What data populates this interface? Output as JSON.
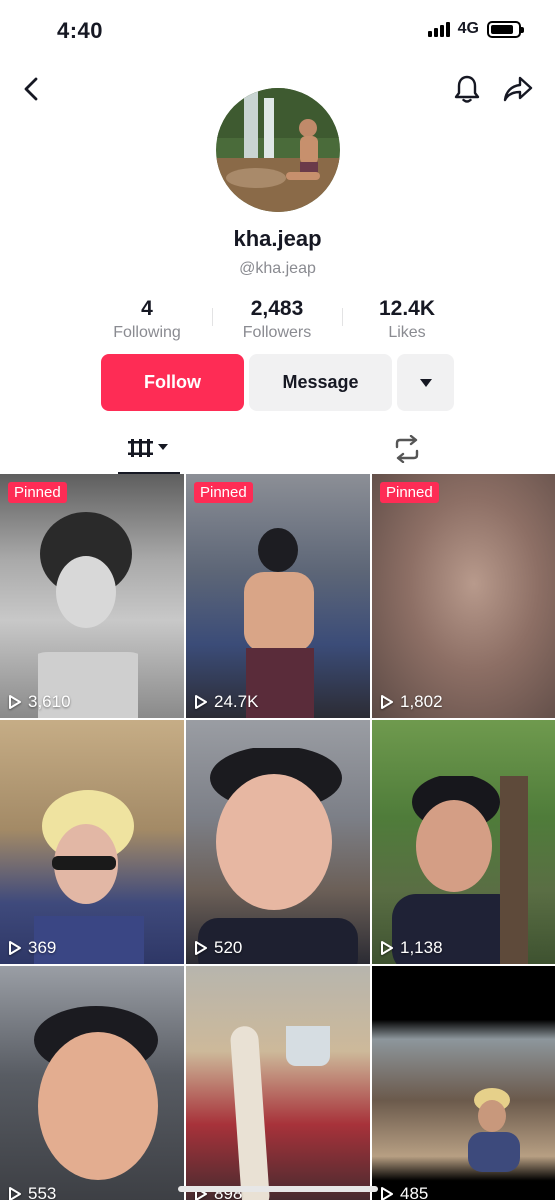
{
  "status_bar": {
    "time": "4:40",
    "network": "4G",
    "battery_level": 0.85
  },
  "nav": {
    "back_icon": "chevron-left-icon",
    "bell_icon": "bell-icon",
    "share_icon": "share-arrow-icon"
  },
  "profile": {
    "name": "kha.jeap",
    "handle": "@kha.jeap",
    "stats": [
      {
        "value": "4",
        "label": "Following"
      },
      {
        "value": "2,483",
        "label": "Followers"
      },
      {
        "value": "12.4K",
        "label": "Likes"
      }
    ]
  },
  "actions": {
    "follow": "Follow",
    "message": "Message"
  },
  "colors": {
    "accent": "#fe2c55",
    "secondary_bg": "#f1f1f2",
    "muted_text": "#8a8b91"
  },
  "videos": [
    {
      "pinned": "Pinned",
      "views": "3,610"
    },
    {
      "pinned": "Pinned",
      "views": "24.7K"
    },
    {
      "pinned": "Pinned",
      "views": "1,802"
    },
    {
      "pinned": "",
      "views": "369"
    },
    {
      "pinned": "",
      "views": "520"
    },
    {
      "pinned": "",
      "views": "1,138"
    },
    {
      "pinned": "",
      "views": "553"
    },
    {
      "pinned": "",
      "views": "898"
    },
    {
      "pinned": "",
      "views": "485"
    }
  ]
}
